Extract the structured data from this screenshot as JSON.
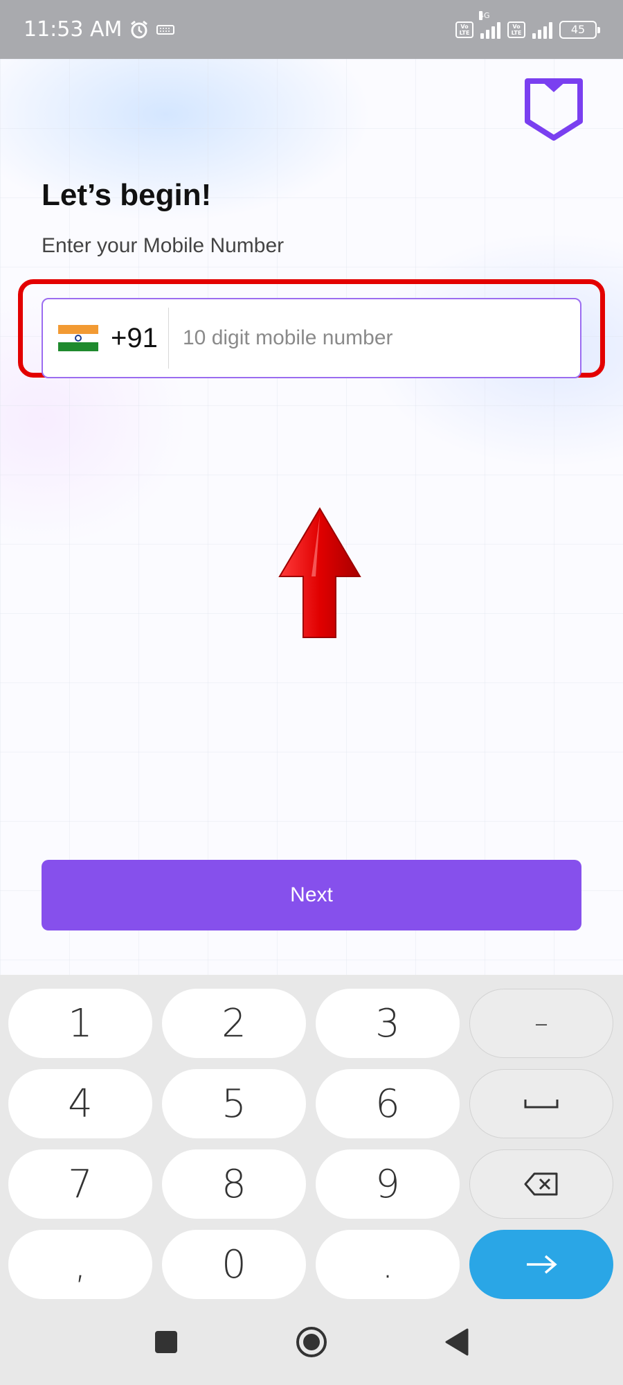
{
  "status_bar": {
    "time": "11:53 AM",
    "network_type": "4G",
    "lte_label": "Vo LTE",
    "battery": "45"
  },
  "app": {
    "title": "Let’s begin!",
    "subtitle": "Enter your Mobile Number",
    "country_code": "+91",
    "phone_placeholder": "10 digit mobile number",
    "phone_value": "",
    "next_label": "Next",
    "brand_color": "#8650ec"
  },
  "keyboard": {
    "keys": [
      "1",
      "2",
      "3",
      "–",
      "4",
      "5",
      "6",
      "space",
      "7",
      "8",
      "9",
      "backspace",
      ",",
      "0",
      ".",
      "enter"
    ],
    "labels": {
      "k1": "1",
      "k2": "2",
      "k3": "3",
      "dash": "–",
      "k4": "4",
      "k5": "5",
      "k6": "6",
      "k7": "7",
      "k8": "8",
      "k9": "9",
      "comma": ",",
      "k0": "0",
      "period": "."
    }
  },
  "icons": {
    "logo": "shield-logo-icon",
    "arrow": "red-up-arrow-icon",
    "alarm": "alarm-icon",
    "keyboard_status": "keyboard-icon",
    "recents": "square-icon",
    "home": "circle-icon",
    "back": "triangle-back-icon"
  }
}
